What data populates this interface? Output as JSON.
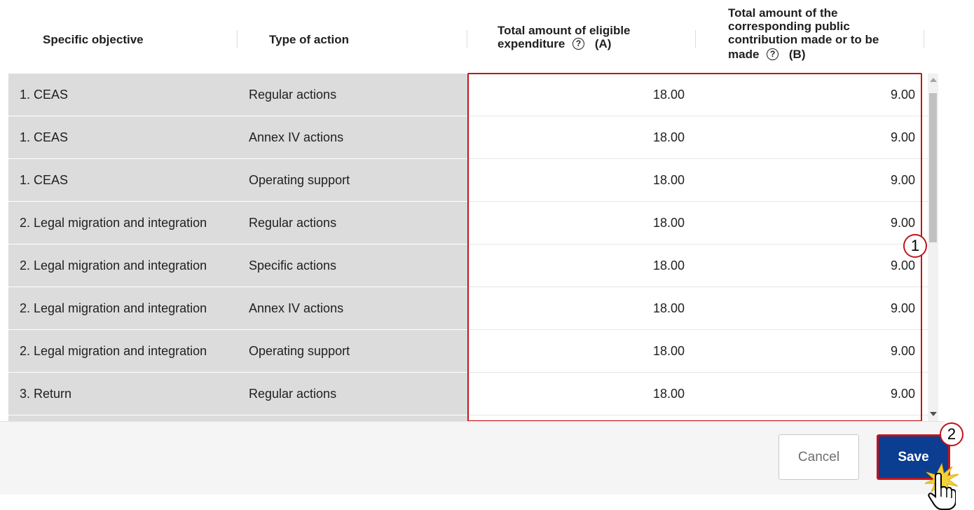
{
  "table": {
    "headers": {
      "objective": "Specific objective",
      "type": "Type of action",
      "a_line1": "Total amount of eligible",
      "a_line2": "expenditure",
      "a_suffix": "(A)",
      "b_line1": "Total amount of the",
      "b_line2": "corresponding public",
      "b_line3": "contribution made or to be",
      "b_line4": "made",
      "b_suffix": "(B)"
    },
    "help_glyph": "?",
    "rows": [
      {
        "objective": "1. CEAS",
        "type": "Regular actions",
        "a": "18.00",
        "b": "9.00"
      },
      {
        "objective": "1. CEAS",
        "type": "Annex IV actions",
        "a": "18.00",
        "b": "9.00"
      },
      {
        "objective": "1. CEAS",
        "type": "Operating support",
        "a": "18.00",
        "b": "9.00"
      },
      {
        "objective": "2. Legal migration and integration",
        "type": "Regular actions",
        "a": "18.00",
        "b": "9.00"
      },
      {
        "objective": "2. Legal migration and integration",
        "type": "Specific actions",
        "a": "18.00",
        "b": "9.00"
      },
      {
        "objective": "2. Legal migration and integration",
        "type": "Annex IV actions",
        "a": "18.00",
        "b": "9.00"
      },
      {
        "objective": "2. Legal migration and integration",
        "type": "Operating support",
        "a": "18.00",
        "b": "9.00"
      },
      {
        "objective": "3. Return",
        "type": "Regular actions",
        "a": "18.00",
        "b": "9.00"
      }
    ]
  },
  "footer": {
    "cancel_label": "Cancel",
    "save_label": "Save"
  },
  "callouts": {
    "one": "1",
    "two": "2"
  },
  "colors": {
    "highlight": "#c0151b",
    "primary": "#0b3d91",
    "readonly_cell": "#dcdcdc"
  }
}
